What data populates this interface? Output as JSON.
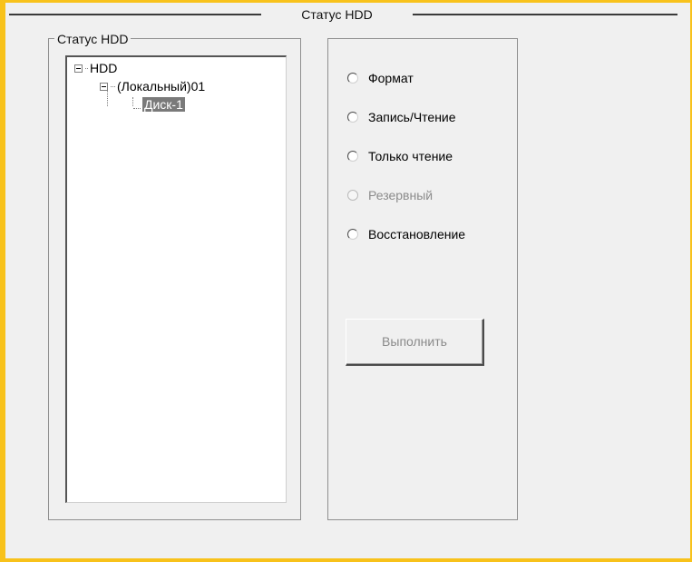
{
  "window": {
    "title": "Статус HDD"
  },
  "tree_group": {
    "legend": "Статус HDD",
    "nodes": [
      {
        "label": "HDD",
        "expanded": true
      },
      {
        "label": "(Локальный)01",
        "expanded": true
      },
      {
        "label": "Диск-1",
        "selected": true
      }
    ]
  },
  "options": [
    {
      "label": "Формат",
      "enabled": true,
      "checked": false
    },
    {
      "label": "Запись/Чтение",
      "enabled": true,
      "checked": false
    },
    {
      "label": "Только чтение",
      "enabled": true,
      "checked": false
    },
    {
      "label": "Резервный",
      "enabled": false,
      "checked": false
    },
    {
      "label": "Восстановление",
      "enabled": true,
      "checked": false
    }
  ],
  "actions": {
    "execute_label": "Выполнить",
    "execute_enabled": false
  },
  "colors": {
    "frame_accent": "#F8C21B",
    "dialog_bg": "#F0F0F0",
    "selection_bg": "#7A7A7A"
  }
}
